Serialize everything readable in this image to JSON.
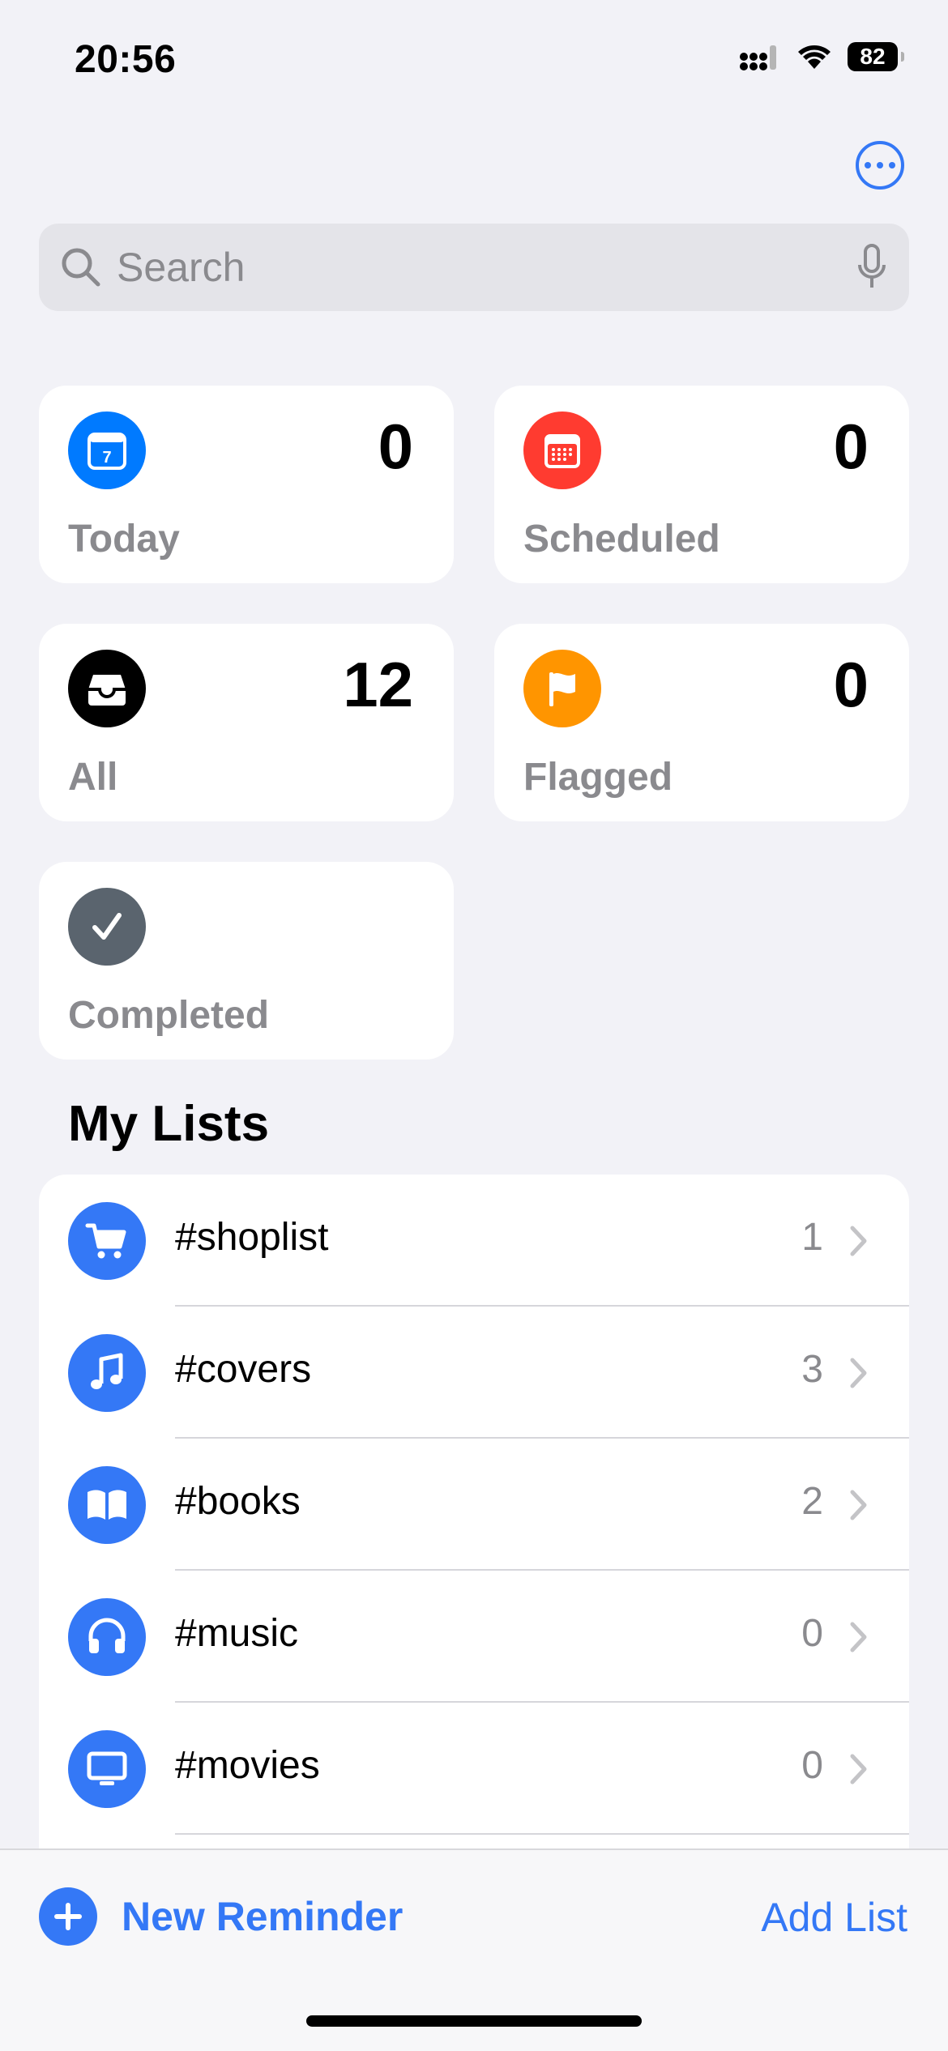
{
  "status_bar": {
    "time": "20:56",
    "battery": "82"
  },
  "search": {
    "placeholder": "Search"
  },
  "smart_lists": [
    {
      "label": "Today",
      "count": "0",
      "color": "#007aff",
      "icon": "calendar-today-icon"
    },
    {
      "label": "Scheduled",
      "count": "0",
      "color": "#ff3b30",
      "icon": "calendar-icon"
    },
    {
      "label": "All",
      "count": "12",
      "color": "#000000",
      "icon": "tray-icon"
    },
    {
      "label": "Flagged",
      "count": "0",
      "color": "#ff9500",
      "icon": "flag-icon"
    },
    {
      "label": "Completed",
      "count": "",
      "color": "#5a646e",
      "icon": "checkmark-icon"
    }
  ],
  "today_day": "7",
  "my_lists": {
    "title": "My Lists",
    "items": [
      {
        "name": "#shoplist",
        "count": "1",
        "icon": "cart-icon"
      },
      {
        "name": "#covers",
        "count": "3",
        "icon": "music-note-icon"
      },
      {
        "name": "#books",
        "count": "2",
        "icon": "book-icon"
      },
      {
        "name": "#music",
        "count": "0",
        "icon": "headphones-icon"
      },
      {
        "name": "#movies",
        "count": "0",
        "icon": "tv-icon"
      }
    ]
  },
  "toolbar": {
    "new_reminder": "New Reminder",
    "add_list": "Add List"
  },
  "colors": {
    "accent": "#3478f6",
    "background": "#f2f2f7"
  }
}
